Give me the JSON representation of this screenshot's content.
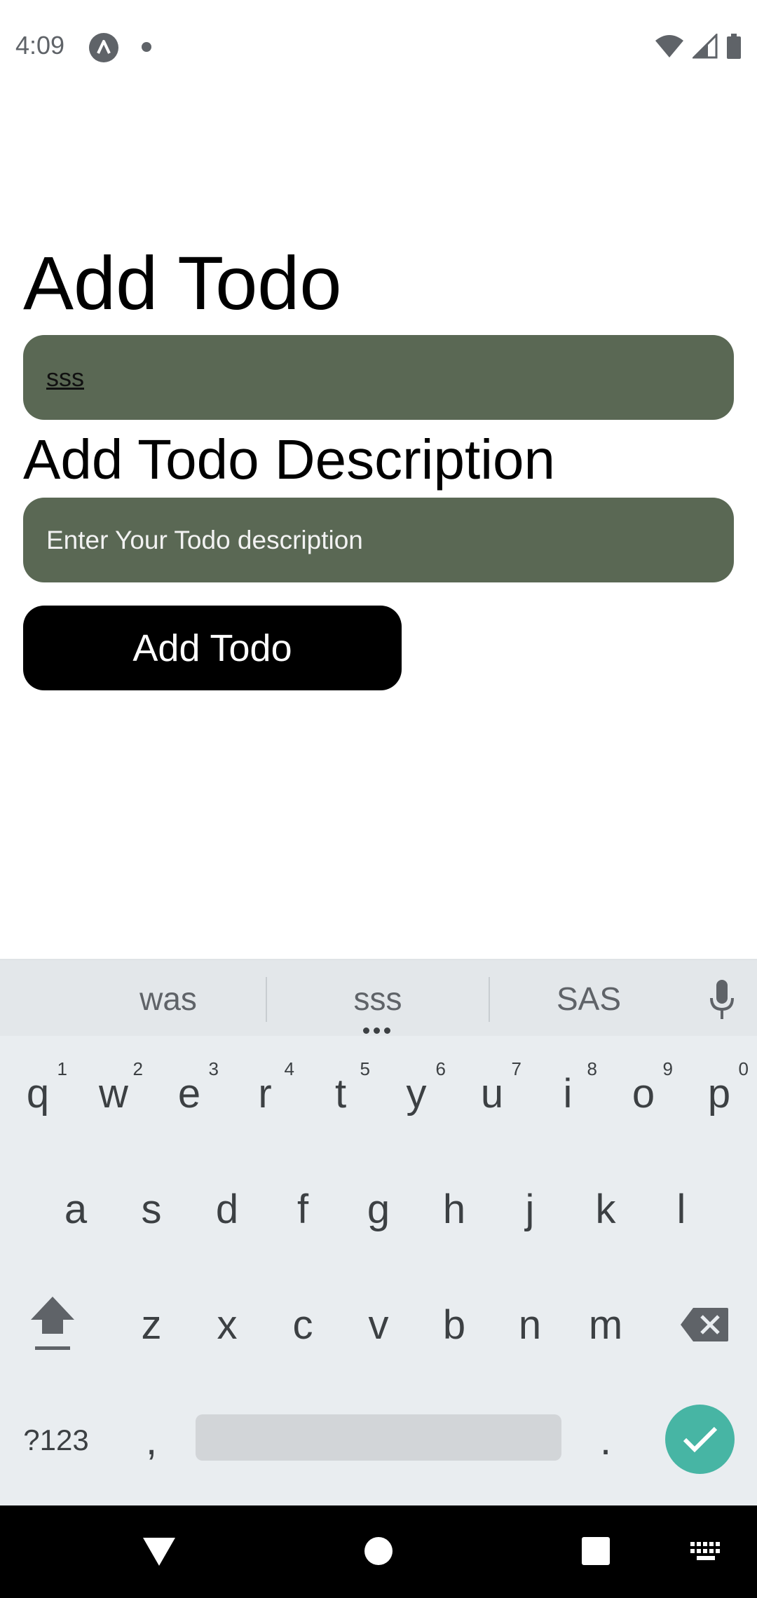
{
  "status_bar": {
    "time": "4:09",
    "icons": [
      "app-notification-icon",
      "dot-icon",
      "wifi-icon",
      "signal-icon",
      "battery-icon"
    ]
  },
  "form": {
    "title_heading": "Add Todo",
    "title_value": "sss",
    "description_heading": "Add Todo Description",
    "description_placeholder": "Enter Your Todo description",
    "submit_label": "Add Todo"
  },
  "keyboard": {
    "suggestions": [
      "was",
      "sss",
      "SAS"
    ],
    "row1": [
      {
        "key": "q",
        "hint": "1"
      },
      {
        "key": "w",
        "hint": "2"
      },
      {
        "key": "e",
        "hint": "3"
      },
      {
        "key": "r",
        "hint": "4"
      },
      {
        "key": "t",
        "hint": "5"
      },
      {
        "key": "y",
        "hint": "6"
      },
      {
        "key": "u",
        "hint": "7"
      },
      {
        "key": "i",
        "hint": "8"
      },
      {
        "key": "o",
        "hint": "9"
      },
      {
        "key": "p",
        "hint": "0"
      }
    ],
    "row2": [
      "a",
      "s",
      "d",
      "f",
      "g",
      "h",
      "j",
      "k",
      "l"
    ],
    "row3": [
      "z",
      "x",
      "c",
      "v",
      "b",
      "n",
      "m"
    ],
    "symbols_label": "?123",
    "comma_label": ",",
    "period_label": "."
  },
  "colors": {
    "field_background": "#5a6854",
    "button_background": "#000000",
    "keyboard_background": "#e9edf0",
    "enter_key": "#47b5a4"
  }
}
